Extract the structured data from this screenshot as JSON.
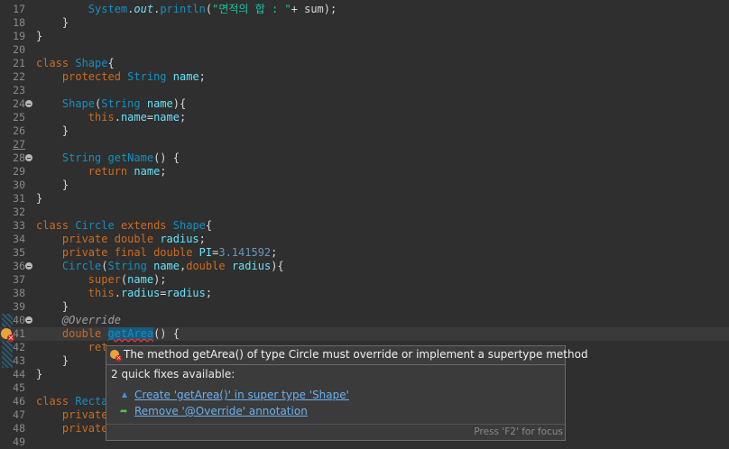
{
  "lines": [
    {
      "n": "17",
      "parts": [
        [
          "",
          "        "
        ],
        [
          "type",
          "System"
        ],
        [
          "",
          "."
        ],
        [
          "fld itl",
          "out"
        ],
        [
          "",
          "."
        ],
        [
          "type",
          "println"
        ],
        [
          "",
          "("
        ],
        [
          "str",
          "\"면적의 합 : \""
        ],
        [
          "",
          "+ sum);"
        ]
      ]
    },
    {
      "n": "18",
      "parts": [
        [
          "",
          "    }"
        ]
      ]
    },
    {
      "n": "19",
      "parts": [
        [
          "",
          "}"
        ]
      ]
    },
    {
      "n": "20",
      "parts": []
    },
    {
      "n": "21",
      "parts": [
        [
          "kw",
          "class"
        ],
        [
          "",
          " "
        ],
        [
          "type",
          "Shape"
        ],
        [
          "",
          "{"
        ]
      ]
    },
    {
      "n": "22",
      "parts": [
        [
          "",
          "    "
        ],
        [
          "kw",
          "protected"
        ],
        [
          "",
          " "
        ],
        [
          "type",
          "String"
        ],
        [
          "",
          " "
        ],
        [
          "fld",
          "name"
        ],
        [
          "",
          ";"
        ]
      ]
    },
    {
      "n": "23",
      "parts": []
    },
    {
      "n": "24",
      "fold": true,
      "parts": [
        [
          "",
          "    "
        ],
        [
          "type",
          "Shape"
        ],
        [
          "",
          "("
        ],
        [
          "type",
          "String"
        ],
        [
          "",
          " "
        ],
        [
          "fld",
          "name"
        ],
        [
          "",
          "){"
        ]
      ]
    },
    {
      "n": "25",
      "parts": [
        [
          "",
          "        "
        ],
        [
          "kw",
          "this"
        ],
        [
          "",
          "."
        ],
        [
          "fld",
          "name"
        ],
        [
          "",
          "="
        ],
        [
          "fld",
          "name"
        ],
        [
          "",
          ";"
        ]
      ]
    },
    {
      "n": "26",
      "parts": [
        [
          "",
          "    }"
        ]
      ]
    },
    {
      "n": "27",
      "ul": true,
      "parts": []
    },
    {
      "n": "28",
      "fold": true,
      "parts": [
        [
          "",
          "    "
        ],
        [
          "type",
          "String"
        ],
        [
          "",
          " "
        ],
        [
          "type",
          "getName"
        ],
        [
          "",
          "() {"
        ]
      ]
    },
    {
      "n": "29",
      "parts": [
        [
          "",
          "        "
        ],
        [
          "kw",
          "return"
        ],
        [
          "",
          " "
        ],
        [
          "fld",
          "name"
        ],
        [
          "",
          ";"
        ]
      ]
    },
    {
      "n": "30",
      "parts": [
        [
          "",
          "    }"
        ]
      ]
    },
    {
      "n": "31",
      "parts": [
        [
          "",
          "}"
        ]
      ]
    },
    {
      "n": "32",
      "parts": []
    },
    {
      "n": "33",
      "parts": [
        [
          "kw",
          "class"
        ],
        [
          "",
          " "
        ],
        [
          "type",
          "Circle"
        ],
        [
          "",
          " "
        ],
        [
          "kw",
          "extends"
        ],
        [
          "",
          " "
        ],
        [
          "type",
          "Shape"
        ],
        [
          "",
          "{"
        ]
      ]
    },
    {
      "n": "34",
      "parts": [
        [
          "",
          "    "
        ],
        [
          "kw",
          "private"
        ],
        [
          "",
          " "
        ],
        [
          "kw",
          "double"
        ],
        [
          "",
          " "
        ],
        [
          "fld",
          "radius"
        ],
        [
          "",
          ";"
        ]
      ]
    },
    {
      "n": "35",
      "parts": [
        [
          "",
          "    "
        ],
        [
          "kw",
          "private"
        ],
        [
          "",
          " "
        ],
        [
          "kw",
          "final"
        ],
        [
          "",
          " "
        ],
        [
          "kw",
          "double"
        ],
        [
          "",
          " "
        ],
        [
          "fld",
          "PI"
        ],
        [
          "",
          "="
        ],
        [
          "num",
          "3.141592"
        ],
        [
          "",
          ";"
        ]
      ]
    },
    {
      "n": "36",
      "fold": true,
      "parts": [
        [
          "",
          "    "
        ],
        [
          "type",
          "Circle"
        ],
        [
          "",
          "("
        ],
        [
          "type",
          "String"
        ],
        [
          "",
          " "
        ],
        [
          "fld",
          "name"
        ],
        [
          "",
          ","
        ],
        [
          "kw",
          "double"
        ],
        [
          "",
          " "
        ],
        [
          "fld",
          "radius"
        ],
        [
          "",
          "){"
        ]
      ]
    },
    {
      "n": "37",
      "parts": [
        [
          "",
          "        "
        ],
        [
          "kw",
          "super"
        ],
        [
          "",
          "("
        ],
        [
          "fld",
          "name"
        ],
        [
          "",
          ");"
        ]
      ]
    },
    {
      "n": "38",
      "parts": [
        [
          "",
          "        "
        ],
        [
          "kw",
          "this"
        ],
        [
          "",
          "."
        ],
        [
          "fld",
          "radius"
        ],
        [
          "",
          "="
        ],
        [
          "fld",
          "radius"
        ],
        [
          "",
          ";"
        ]
      ]
    },
    {
      "n": "39",
      "parts": [
        [
          "",
          "    }"
        ]
      ]
    },
    {
      "n": "40",
      "fold": true,
      "parts": [
        [
          "",
          "    "
        ],
        [
          "ann",
          "@Override"
        ]
      ]
    },
    {
      "n": "41",
      "current": true,
      "error": true,
      "parts": [
        [
          "",
          "    "
        ],
        [
          "kw",
          "double"
        ],
        [
          "",
          " "
        ],
        [
          "type sel",
          "getArea"
        ],
        [
          "",
          "() {"
        ]
      ]
    },
    {
      "n": "42",
      "parts": [
        [
          "",
          "        "
        ],
        [
          "kw",
          "ret"
        ]
      ]
    },
    {
      "n": "43",
      "parts": [
        [
          "",
          "    }"
        ]
      ]
    },
    {
      "n": "44",
      "parts": [
        [
          "",
          "}"
        ]
      ]
    },
    {
      "n": "45",
      "parts": []
    },
    {
      "n": "46",
      "parts": [
        [
          "kw",
          "class"
        ],
        [
          "",
          " "
        ],
        [
          "type",
          "Recta"
        ]
      ]
    },
    {
      "n": "47",
      "parts": [
        [
          "",
          "    "
        ],
        [
          "kw",
          "private"
        ]
      ]
    },
    {
      "n": "48",
      "parts": [
        [
          "",
          "    "
        ],
        [
          "kw",
          "private"
        ]
      ]
    },
    {
      "n": "49",
      "parts": []
    }
  ],
  "popup": {
    "message": "The method getArea() of type Circle must override or implement a supertype method",
    "count": "2 quick fixes available:",
    "fixes": [
      {
        "label": "Create 'getArea()' in super type 'Shape'",
        "icon": "create-method-icon"
      },
      {
        "label": "Remove '@Override' annotation",
        "icon": "remove-annotation-icon"
      }
    ],
    "focus_hint": "Press 'F2' for focus"
  },
  "colors": {
    "background": "#2f2f2f",
    "keyword": "#cc6c1d",
    "type": "#1290c3",
    "field": "#66e1f8",
    "string": "#17c6a3",
    "link": "#6ab0f0"
  }
}
